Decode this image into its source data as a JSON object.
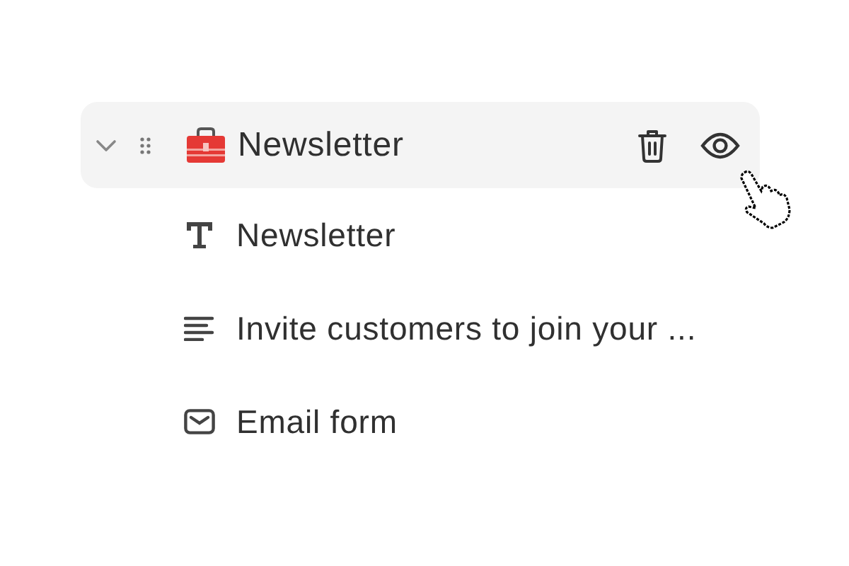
{
  "section": {
    "title": "Newsletter",
    "expanded": true
  },
  "blocks": [
    {
      "kind": "heading",
      "label": "Newsletter"
    },
    {
      "kind": "text",
      "label": "Invite customers to join your ..."
    },
    {
      "kind": "email_form",
      "label": "Email form"
    }
  ]
}
